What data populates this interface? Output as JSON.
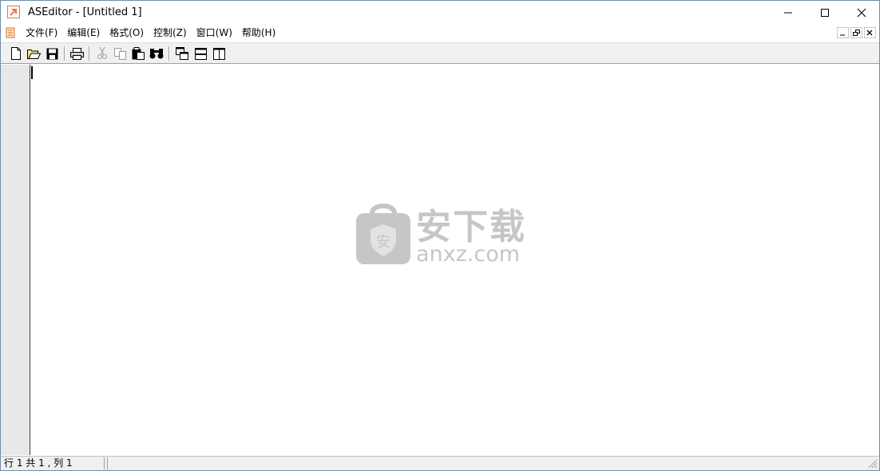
{
  "window": {
    "title": "ASEditor - [Untitled 1]"
  },
  "menu": {
    "items": [
      {
        "label": "文件(F)"
      },
      {
        "label": "编辑(E)"
      },
      {
        "label": "格式(O)"
      },
      {
        "label": "控制(Z)"
      },
      {
        "label": "窗口(W)"
      },
      {
        "label": "帮助(H)"
      }
    ]
  },
  "toolbar": {
    "icons": [
      "new-file-icon",
      "open-folder-icon",
      "save-icon",
      "print-icon",
      "cut-icon",
      "copy-icon",
      "paste-icon",
      "find-icon",
      "window-cascade-icon",
      "split-horizontal-icon",
      "split-vertical-icon"
    ]
  },
  "watermark": {
    "cn": "安下载",
    "en": "anxz.com",
    "badge": "安"
  },
  "status": {
    "position": "行 1 共 1 , 列 1"
  },
  "colors": {
    "accent": "#e8763a",
    "gutter": "#e8e8e8",
    "chrome": "#f0f0f0",
    "watermark": "#c6c6c6"
  }
}
